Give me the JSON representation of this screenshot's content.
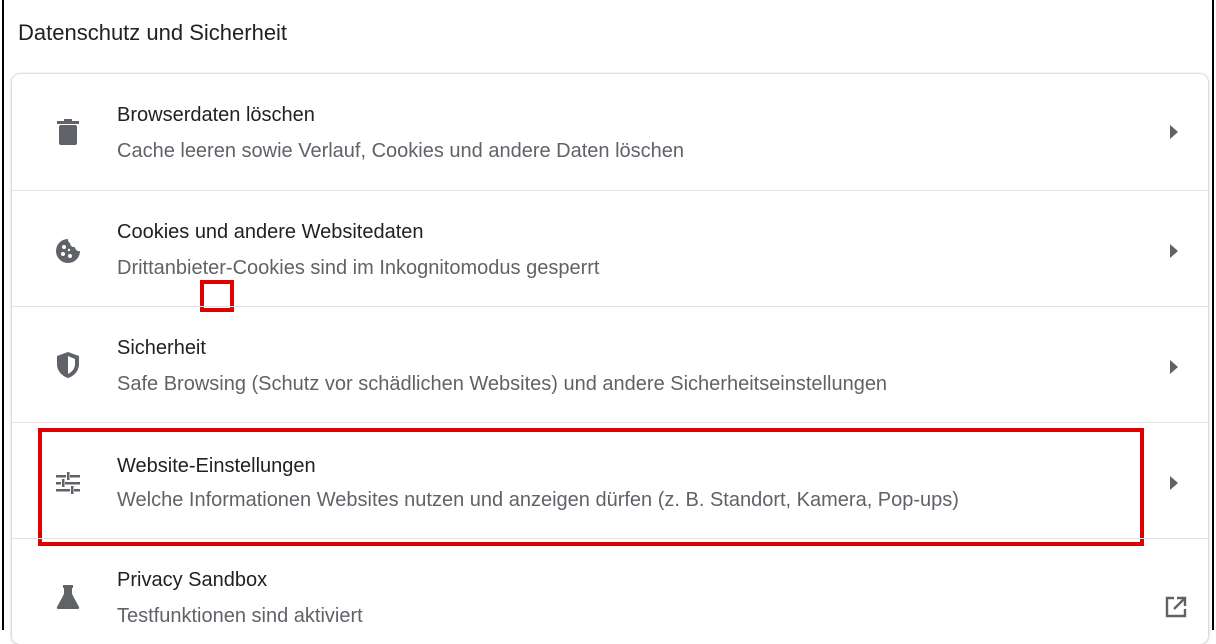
{
  "section": {
    "title": "Datenschutz und Sicherheit"
  },
  "rows": [
    {
      "title": "Browserdaten löschen",
      "subtitle": "Cache leeren sowie Verlauf, Cookies und andere Daten löschen",
      "icon": "trash-icon",
      "action": "arrow-right-icon"
    },
    {
      "title": "Cookies und andere Websitedaten",
      "subtitle": "Drittanbieter-Cookies sind im Inkognitomodus gesperrt",
      "icon": "cookie-icon",
      "action": "arrow-right-icon"
    },
    {
      "title": "Sicherheit",
      "subtitle": "Safe Browsing (Schutz vor schädlichen Websites) und andere Sicherheitseinstellungen",
      "icon": "shield-icon",
      "action": "arrow-right-icon"
    },
    {
      "title": "Website-Einstellungen",
      "subtitle": "Welche Informationen Websites nutzen und anzeigen dürfen (z. B. Standort, Kamera, Pop-ups)",
      "icon": "tune-sliders-icon",
      "action": "arrow-right-icon"
    },
    {
      "title": "Privacy Sandbox",
      "subtitle": "Testfunktionen sind aktiviert",
      "icon": "flask-icon",
      "action": "external-link-icon"
    }
  ],
  "colors": {
    "highlight": "#e00000",
    "icon": "#5f6368",
    "title": "#202124",
    "subtitle": "#5f6368"
  }
}
